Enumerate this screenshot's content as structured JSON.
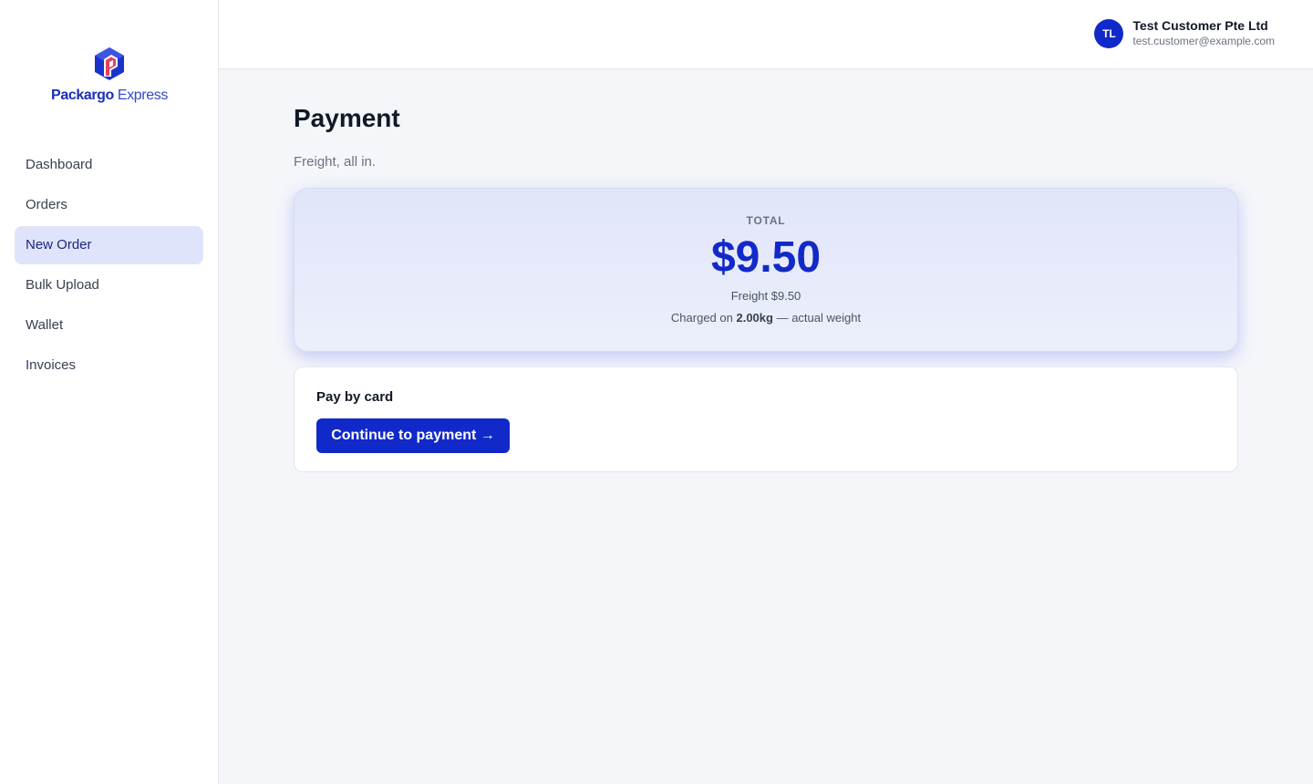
{
  "brand": {
    "name_strong": "Packargo",
    "name_light": " Express",
    "colors": {
      "primary": "#1229c9",
      "logo_accent": "#e2445c",
      "active_nav_bg": "#e0e4fb"
    }
  },
  "sidebar": {
    "items": [
      {
        "label": "Dashboard",
        "active": false
      },
      {
        "label": "Orders",
        "active": false
      },
      {
        "label": "New Order",
        "active": true
      },
      {
        "label": "Bulk Upload",
        "active": false
      },
      {
        "label": "Wallet",
        "active": false
      },
      {
        "label": "Invoices",
        "active": false
      }
    ]
  },
  "header": {
    "user": {
      "initials": "TL",
      "name": "Test Customer Pte Ltd",
      "email": "test.customer@example.com"
    }
  },
  "page": {
    "title": "Payment",
    "subtitle": "Freight, all in."
  },
  "summary": {
    "total_label": "TOTAL",
    "total_amount": "$9.50",
    "freight_line": "Freight $9.50",
    "charged_prefix": "Charged on ",
    "charged_weight": "2.00kg",
    "charged_suffix": " — actual weight"
  },
  "payment": {
    "title": "Pay by card",
    "button_label": "Continue to payment →"
  }
}
